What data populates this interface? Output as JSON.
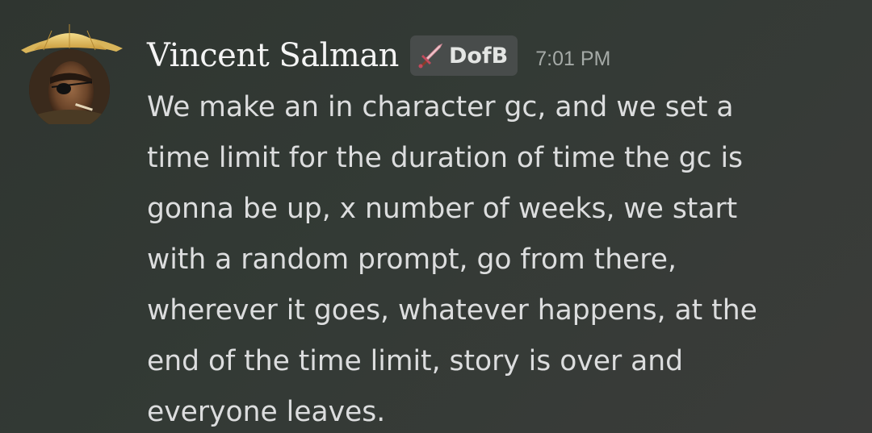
{
  "message": {
    "author": {
      "name": "Vincent Salman",
      "avatar_icon": "user-avatar"
    },
    "role_tag": {
      "icon": "sword-icon",
      "label": "DofB"
    },
    "timestamp": "7:01 PM",
    "lines": [
      "We make an in character gc, and we set a",
      "time limit for the duration of time the gc is",
      "gonna be up, x number of weeks, we start",
      "with a random prompt, go from there,",
      "wherever it goes, whatever happens, at the",
      "end of the time limit, story is over and",
      "everyone leaves."
    ]
  },
  "colors": {
    "background": "#313733",
    "author_name": "#f4f4f4",
    "message_text": "#dcddde",
    "timestamp": "#a5aaa7",
    "role_tag_bg": "#484c4b"
  }
}
